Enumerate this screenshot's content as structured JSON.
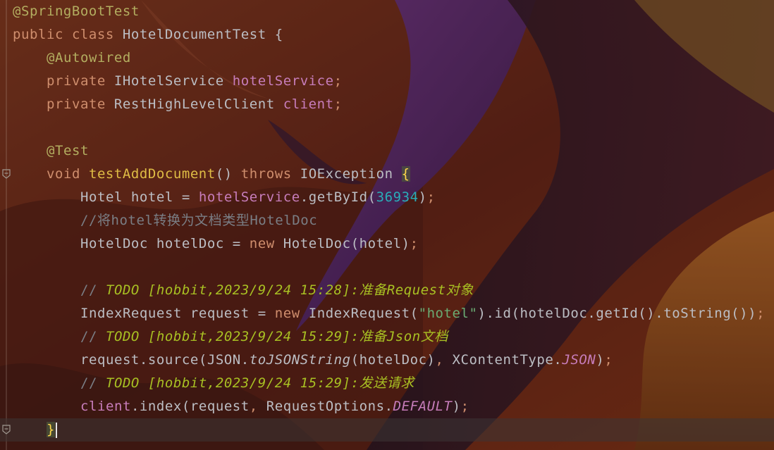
{
  "editor": {
    "language": "Java",
    "lines": [
      {
        "indent": 0,
        "tokens": [
          {
            "t": "@SpringBootTest",
            "c": "ann"
          }
        ]
      },
      {
        "indent": 0,
        "tokens": [
          {
            "t": "public ",
            "c": "kw"
          },
          {
            "t": "class ",
            "c": "kw"
          },
          {
            "t": "HotelDocumentTest ",
            "c": "punc"
          },
          {
            "t": "{",
            "c": "punc"
          }
        ]
      },
      {
        "indent": 1,
        "tokens": [
          {
            "t": "@Autowired",
            "c": "ann"
          }
        ]
      },
      {
        "indent": 1,
        "tokens": [
          {
            "t": "private ",
            "c": "kw"
          },
          {
            "t": "IHotelService ",
            "c": "punc"
          },
          {
            "t": "hotelService",
            "c": "fld"
          },
          {
            "t": ";",
            "c": "kw"
          }
        ]
      },
      {
        "indent": 1,
        "tokens": [
          {
            "t": "private ",
            "c": "kw"
          },
          {
            "t": "RestHighLevelClient ",
            "c": "punc"
          },
          {
            "t": "client",
            "c": "fld"
          },
          {
            "t": ";",
            "c": "kw"
          }
        ]
      },
      {
        "indent": 0,
        "tokens": []
      },
      {
        "indent": 1,
        "tokens": [
          {
            "t": "@Test",
            "c": "ann"
          }
        ]
      },
      {
        "indent": 1,
        "fold": true,
        "tokens": [
          {
            "t": "void ",
            "c": "kw"
          },
          {
            "t": "testAddDocument",
            "c": "fnd"
          },
          {
            "t": "() ",
            "c": "punc"
          },
          {
            "t": "throws ",
            "c": "kw"
          },
          {
            "t": "IOException ",
            "c": "punc"
          },
          {
            "t": "{",
            "c": "brace-hl"
          }
        ]
      },
      {
        "indent": 2,
        "tokens": [
          {
            "t": "Hotel hotel = ",
            "c": "punc"
          },
          {
            "t": "hotelService",
            "c": "fld"
          },
          {
            "t": ".getById(",
            "c": "punc"
          },
          {
            "t": "36934",
            "c": "num"
          },
          {
            "t": ")",
            "c": "punc"
          },
          {
            "t": ";",
            "c": "kw"
          }
        ]
      },
      {
        "indent": 2,
        "tokens": [
          {
            "t": "//将hotel转换为文档类型HotelDoc",
            "c": "cmt"
          }
        ]
      },
      {
        "indent": 2,
        "tokens": [
          {
            "t": "HotelDoc hotelDoc = ",
            "c": "punc"
          },
          {
            "t": "new ",
            "c": "kw"
          },
          {
            "t": "HotelDoc(hotel)",
            "c": "punc"
          },
          {
            "t": ";",
            "c": "kw"
          }
        ]
      },
      {
        "indent": 0,
        "tokens": []
      },
      {
        "indent": 2,
        "tokens": [
          {
            "t": "// ",
            "c": "cmt"
          },
          {
            "t": "TODO [hobbit,2023/9/24 15:28]:准备Request对象",
            "c": "todo"
          }
        ]
      },
      {
        "indent": 2,
        "tokens": [
          {
            "t": "IndexRequest request = ",
            "c": "punc"
          },
          {
            "t": "new ",
            "c": "kw"
          },
          {
            "t": "IndexRequest(",
            "c": "punc"
          },
          {
            "t": "\"hotel\"",
            "c": "str"
          },
          {
            "t": ").id(hotelDoc.getId().toString())",
            "c": "punc"
          },
          {
            "t": ";",
            "c": "kw"
          }
        ]
      },
      {
        "indent": 2,
        "tokens": [
          {
            "t": "// ",
            "c": "cmt"
          },
          {
            "t": "TODO [hobbit,2023/9/24 15:29]:准备Json文档",
            "c": "todo"
          }
        ]
      },
      {
        "indent": 2,
        "tokens": [
          {
            "t": "request.source(JSON.",
            "c": "punc"
          },
          {
            "t": "toJSONString",
            "c": "stm"
          },
          {
            "t": "(hotelDoc)",
            "c": "punc"
          },
          {
            "t": ", ",
            "c": "kw"
          },
          {
            "t": "XContentType.",
            "c": "punc"
          },
          {
            "t": "JSON",
            "c": "stat"
          },
          {
            "t": ")",
            "c": "punc"
          },
          {
            "t": ";",
            "c": "kw"
          }
        ]
      },
      {
        "indent": 2,
        "tokens": [
          {
            "t": "// ",
            "c": "cmt"
          },
          {
            "t": "TODO [hobbit,2023/9/24 15:29]:发送请求",
            "c": "todo"
          }
        ]
      },
      {
        "indent": 2,
        "tokens": [
          {
            "t": "client",
            "c": "fld"
          },
          {
            "t": ".index(request",
            "c": "punc"
          },
          {
            "t": ", ",
            "c": "kw"
          },
          {
            "t": "RequestOptions.",
            "c": "punc"
          },
          {
            "t": "DEFAULT",
            "c": "stat"
          },
          {
            "t": ")",
            "c": "punc"
          },
          {
            "t": ";",
            "c": "kw"
          }
        ]
      },
      {
        "indent": 1,
        "fold": true,
        "current": true,
        "caret": true,
        "tokens": [
          {
            "t": "}",
            "c": "brace-hl"
          }
        ]
      }
    ]
  },
  "colors": {
    "annotation": "#b3ae60",
    "keyword": "#cf8e6d",
    "field": "#c77dbb",
    "method_decl": "#dfbd45",
    "number": "#2aacb8",
    "string": "#6aab73",
    "comment": "#7a7e85",
    "todo": "#a8c023",
    "text": "#bcbec4"
  }
}
